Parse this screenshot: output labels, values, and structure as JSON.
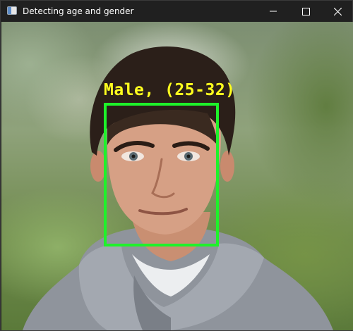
{
  "window": {
    "title": "Detecting age and gender"
  },
  "titlebar_icons": {
    "app": "app-window-icon",
    "minimize": "minimize-icon",
    "maximize": "maximize-icon",
    "close": "close-icon"
  },
  "detection": {
    "label": "Male, (25-32)",
    "box_color": "#1ef22a",
    "label_color": "#ffff1e"
  }
}
